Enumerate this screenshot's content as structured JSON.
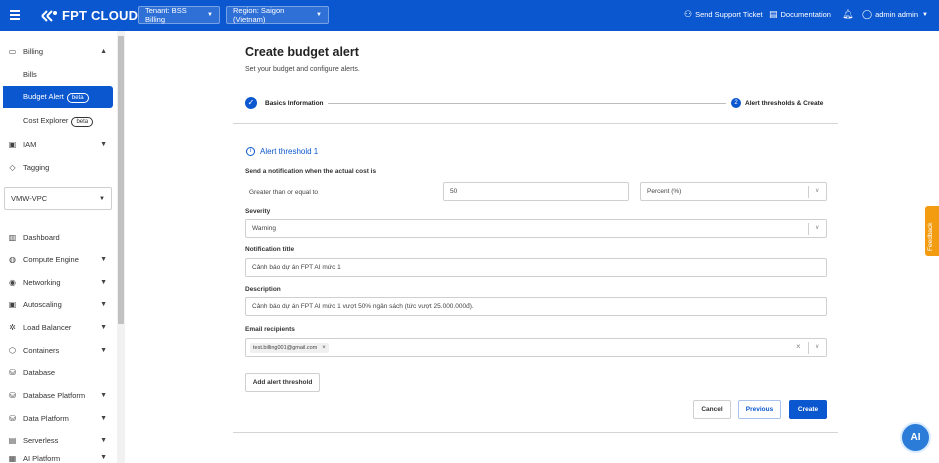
{
  "topbar": {
    "brand": "FPT CLOUD",
    "tenant": "Tenant: BSS Billing",
    "region": "Region: Saigon (Vietnam)",
    "support": "Send Support Ticket",
    "documentation": "Documentation",
    "user": "admin admin"
  },
  "sidebar": {
    "billing": "Billing",
    "bills": "Bills",
    "budget_alert": "Budget Alert",
    "cost_explorer": "Cost Explorer",
    "beta": "beta",
    "iam": "IAM",
    "tagging": "Tagging",
    "vpc": "VMW-VPC",
    "dashboard": "Dashboard",
    "compute_engine": "Compute Engine",
    "networking": "Networking",
    "autoscaling": "Autoscaling",
    "load_balancer": "Load Balancer",
    "containers": "Containers",
    "database": "Database",
    "database_platform": "Database Platform",
    "data_platform": "Data Platform",
    "serverless": "Serverless",
    "ai_platform": "AI Platform"
  },
  "page": {
    "title": "Create budget alert",
    "subtitle": "Set your budget and configure alerts.",
    "step1": "Basics Information",
    "step2_num": "2",
    "step2": "Alert thresholds & Create"
  },
  "form": {
    "threshold_title": "Alert threshold 1",
    "send_label": "Send a notification when the actual cost is",
    "condition": "Greater than or equal to",
    "amount": "50",
    "unit": "Percent (%)",
    "severity_label": "Severity",
    "severity": "Warning",
    "notification_title_label": "Notification title",
    "notification_title": "Cảnh báo dự án FPT AI mức 1",
    "description_label": "Description",
    "description": "Cảnh báo dự án FPT AI mức 1 vượt 50% ngân sách (tức vượt 25.000.000đ).",
    "email_label": "Email recipients",
    "email_chip": "test.billing001@gmail.com",
    "add_threshold": "Add alert threshold"
  },
  "actions": {
    "cancel": "Cancel",
    "previous": "Previous",
    "create": "Create"
  },
  "feedback": "Feedback",
  "colors": {
    "brand": "#0b57d0",
    "feedback": "#f39c12"
  }
}
